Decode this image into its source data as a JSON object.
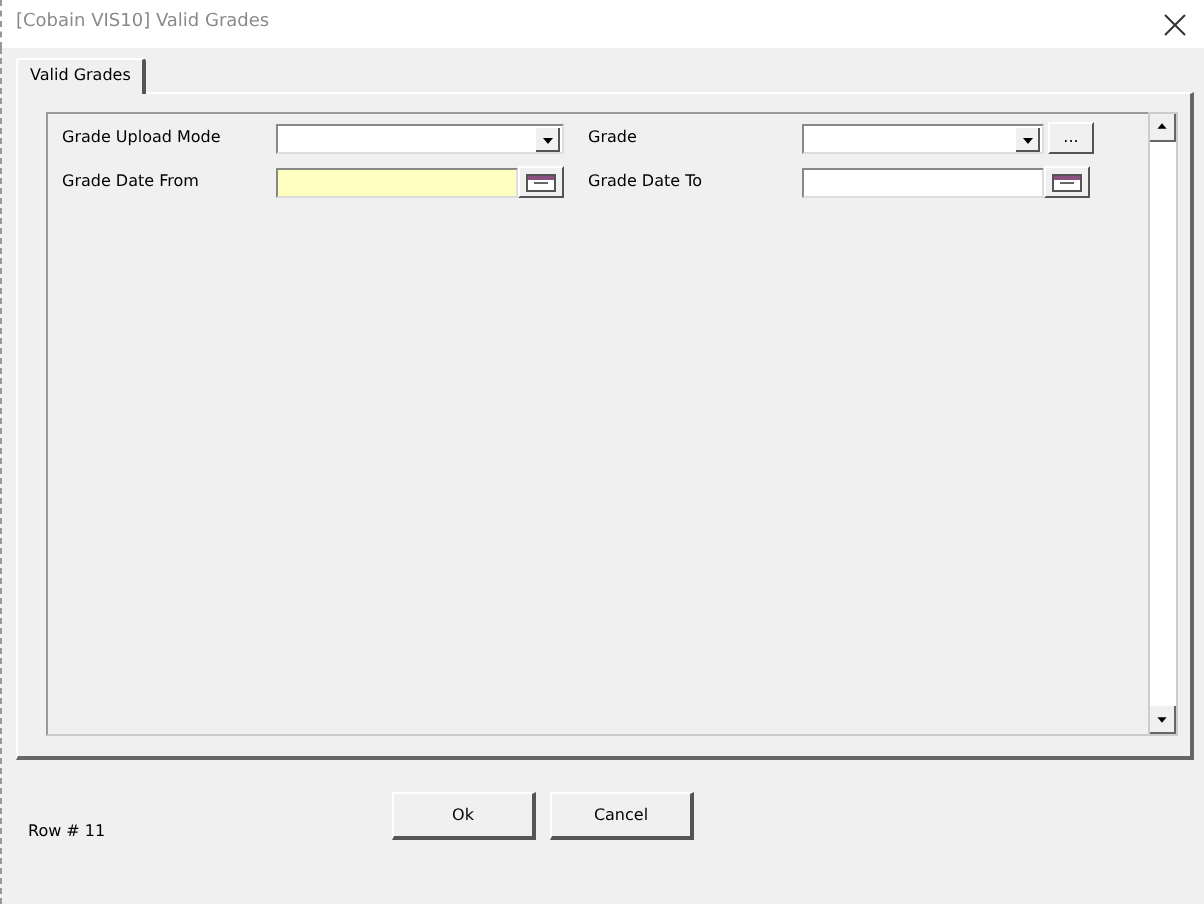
{
  "window": {
    "title": "[Cobain VIS10] Valid Grades"
  },
  "tabs": [
    {
      "label": "Valid Grades",
      "selected": true
    }
  ],
  "fields": [
    {
      "kind": "combo",
      "label": "Grade Upload Mode",
      "highlighted": false
    },
    {
      "kind": "combo",
      "label": "Grade",
      "highlighted": false,
      "browse": "..."
    },
    {
      "kind": "date",
      "label": "Grade Date From",
      "highlighted": true
    },
    {
      "kind": "date",
      "label": "Grade Date To",
      "highlighted": false
    }
  ],
  "footer": {
    "row_label": "Row # 11",
    "buttons": [
      "Ok",
      "Cancel"
    ]
  }
}
